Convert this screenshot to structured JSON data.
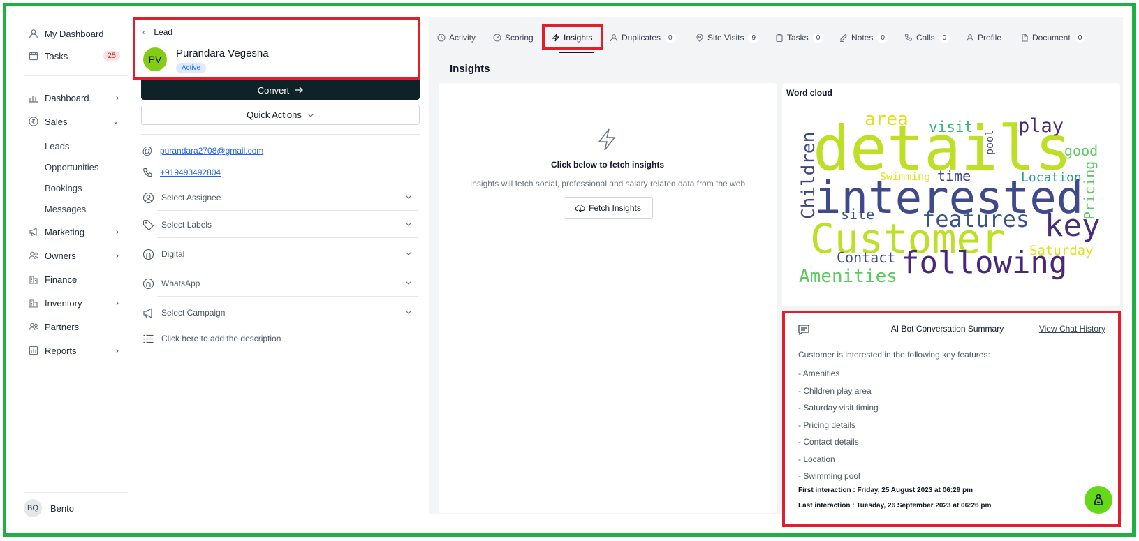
{
  "sidebar": {
    "top_items": [
      {
        "label": "My Dashboard",
        "icon": "user-icon"
      },
      {
        "label": "Tasks",
        "icon": "calendar-icon",
        "count": "25"
      }
    ],
    "items": [
      {
        "label": "Dashboard",
        "icon": "bar-chart-icon"
      },
      {
        "label": "Sales",
        "icon": "rupee-icon"
      },
      {
        "label": "Marketing",
        "icon": "megaphone-icon"
      },
      {
        "label": "Owners",
        "icon": "users-icon"
      },
      {
        "label": "Finance",
        "icon": "building-icon"
      },
      {
        "label": "Inventory",
        "icon": "building-icon"
      },
      {
        "label": "Partners",
        "icon": "users-icon"
      },
      {
        "label": "Reports",
        "icon": "report-icon"
      }
    ],
    "sales_subitems": [
      "Leads",
      "Opportunities",
      "Bookings",
      "Messages"
    ],
    "user": {
      "initials": "BQ",
      "name": "Bento"
    }
  },
  "lead": {
    "breadcrumb": "Lead",
    "initials": "PV",
    "name": "Purandara  Vegesna",
    "status": "Active",
    "convert_label": "Convert",
    "quick_actions_label": "Quick Actions",
    "email": "purandara2708@gmail.com",
    "phone": "+919493492804",
    "selects": [
      {
        "label": "Select Assignee",
        "icon": "user-circle-icon"
      },
      {
        "label": "Select Labels",
        "icon": "tag-icon"
      },
      {
        "label": "Digital",
        "icon": "source-icon"
      },
      {
        "label": "WhatsApp",
        "icon": "source-icon"
      },
      {
        "label": "Select Campaign",
        "icon": "megaphone-icon"
      }
    ],
    "description_placeholder": "Click here to add the description"
  },
  "tabs": [
    {
      "label": "Activity",
      "icon": "clock-icon"
    },
    {
      "label": "Scoring",
      "icon": "gauge-icon"
    },
    {
      "label": "Insights",
      "icon": "bolt-icon"
    },
    {
      "label": "Duplicates",
      "icon": "user-icon",
      "count": "0"
    },
    {
      "label": "Site Visits",
      "icon": "pin-icon",
      "count": "9"
    },
    {
      "label": "Tasks",
      "icon": "clipboard-icon",
      "count": "0"
    },
    {
      "label": "Notes",
      "icon": "pencil-icon",
      "count": "0"
    },
    {
      "label": "Calls",
      "icon": "phone-icon",
      "count": "0"
    },
    {
      "label": "Profile",
      "icon": "user-icon"
    },
    {
      "label": "Document",
      "icon": "document-icon",
      "count": "0"
    }
  ],
  "insights": {
    "title": "Insights",
    "fetch_heading": "Click below to fetch insights",
    "fetch_subtext": "Insights will fetch social, professional and salary related data from the web",
    "fetch_button": "Fetch Insights"
  },
  "word_cloud": {
    "title": "Word cloud",
    "words": [
      "details",
      "interested",
      "Customer",
      "following",
      "key",
      "features",
      "Children",
      "Amenities",
      "play",
      "area",
      "visit",
      "pool",
      "good",
      "Location",
      "Pricing",
      "time",
      "Swimming",
      "site",
      "Contact",
      "Saturday"
    ]
  },
  "ai_summary": {
    "title": "AI Bot Conversation Summary",
    "link": "View Chat History",
    "intro": "Customer is interested in the following key features:",
    "items": [
      "- Amenities",
      "- Children play area",
      "- Saturday visit timing",
      "- Pricing details",
      "- Contact details",
      "- Location",
      "- Swimming pool"
    ],
    "first_interaction": "First interaction : Friday, 25 August 2023 at 06:29 pm",
    "last_interaction": "Last interaction : Tuesday, 26 September 2023 at 06:26 pm"
  },
  "colors": {
    "frame": "#1fb043",
    "highlight": "#e11d2e",
    "accent": "#0f2228",
    "fab": "#65d81a"
  }
}
